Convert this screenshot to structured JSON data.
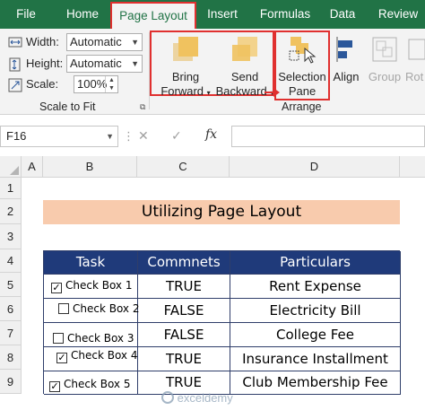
{
  "ribbon_tabs": [
    "File",
    "Home",
    "Page Layout",
    "Insert",
    "Formulas",
    "Data",
    "Review"
  ],
  "active_tab": "Page Layout",
  "scale_to_fit": {
    "width_label": "Width:",
    "width_value": "Automatic",
    "height_label": "Height:",
    "height_value": "Automatic",
    "scale_label": "Scale:",
    "scale_value": "100%",
    "group_label": "Scale to Fit"
  },
  "arrange": {
    "bring_forward_1": "Bring",
    "bring_forward_2": "Forward",
    "send_backward_1": "Send",
    "send_backward_2": "Backward",
    "selection_pane_1": "Selection",
    "selection_pane_2": "Pane",
    "align": "Align",
    "group": "Group",
    "rotate": "Rot",
    "group_label": "Arrange"
  },
  "formula_bar": {
    "name_box": "F16",
    "fx": "fx",
    "cancel": "✕",
    "enter": "✓"
  },
  "columns": [
    "A",
    "B",
    "C",
    "D"
  ],
  "rows": [
    "1",
    "2",
    "3",
    "4",
    "5",
    "6",
    "7",
    "8",
    "9"
  ],
  "title": "Utilizing Page Layout",
  "table": {
    "headers": [
      "Task",
      "Commnets",
      "Particulars"
    ],
    "rows": [
      {
        "task": "Check Box 1",
        "checked": true,
        "comment": "TRUE",
        "particular": "Rent Expense"
      },
      {
        "task": "Check Box 2",
        "checked": false,
        "comment": "FALSE",
        "particular": "Electricity Bill"
      },
      {
        "task": "Check Box 3",
        "checked": false,
        "comment": "FALSE",
        "particular": "College Fee"
      },
      {
        "task": "Check Box 4",
        "checked": true,
        "comment": "TRUE",
        "particular": "Insurance Installment"
      },
      {
        "task": "Check Box 5",
        "checked": true,
        "comment": "TRUE",
        "particular": "Club Membership Fee"
      }
    ]
  },
  "watermark": "exceldemy",
  "colors": {
    "ribbon_green": "#217346",
    "highlight_red": "#e0302f",
    "title_fill": "#f8cbad",
    "table_header": "#1f3a7a"
  }
}
